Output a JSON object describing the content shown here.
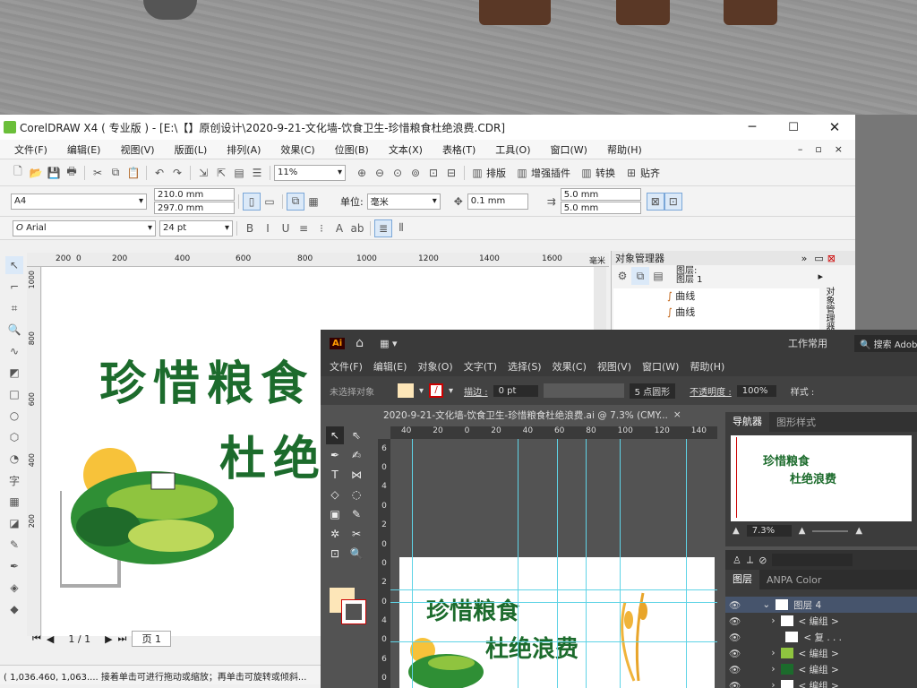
{
  "corel": {
    "title": "CorelDRAW X4 ( 专业版 ) - [E:\\【】原创设计\\2020-9-21-文化墙-饮食卫生-珍惜粮食杜绝浪费.CDR]",
    "menu": [
      "文件(F)",
      "编辑(E)",
      "视图(V)",
      "版面(L)",
      "排列(A)",
      "效果(C)",
      "位图(B)",
      "文本(X)",
      "表格(T)",
      "工具(O)",
      "窗口(W)",
      "帮助(H)"
    ],
    "zoom": "11%",
    "plugins": [
      "排版",
      "增强插件",
      "转换",
      "贴齐"
    ],
    "paper": "A4",
    "width": "210.0 mm",
    "height": "297.0 mm",
    "unit_label": "单位:",
    "unit": "毫米",
    "nudge": "0.1 mm",
    "dup_x": "5.0 mm",
    "dup_y": "5.0 mm",
    "font": "Arial",
    "font_size": "24 pt",
    "ruler_x": [
      "200",
      "0",
      "200",
      "400",
      "600",
      "800",
      "1000",
      "1200",
      "1400",
      "1600"
    ],
    "ruler_unit": "毫米",
    "ruler_y": [
      "1000",
      "800",
      "600",
      "400",
      "200"
    ],
    "obj_mgr": {
      "title": "对象管理器",
      "layer_a": "图层:",
      "layer_b": "图层 1",
      "items": [
        "曲线",
        "曲线"
      ],
      "side": "对象管理器"
    },
    "page_nav": "1 / 1",
    "page_tab": "页 1",
    "status": "( 1,036.460, 1,063.... 接着单击可进行拖动或缩放；再单击可旋转或倾斜...",
    "art_line1": "珍惜粮食",
    "art_line2": "杜绝"
  },
  "ai": {
    "logo": "Ai",
    "workspace": "工作常用",
    "search": "搜索 Adobe",
    "menu": [
      "文件(F)",
      "编辑(E)",
      "对象(O)",
      "文字(T)",
      "选择(S)",
      "效果(C)",
      "视图(V)",
      "窗口(W)",
      "帮助(H)"
    ],
    "no_sel": "未选择对象",
    "stroke_label": "描边 :",
    "stroke_val": "0 pt",
    "brush": "5 点圆形",
    "opacity_label": "不透明度 :",
    "opacity": "100%",
    "style_label": "样式 :",
    "doc_tab": "2020-9-21-文化墙-饮食卫生-珍惜粮食杜绝浪费.ai @ 7.3% (CMY...",
    "ruler": [
      "40",
      "20",
      "0",
      "20",
      "40",
      "60",
      "80",
      "100",
      "120",
      "140"
    ],
    "ruler_v": [
      "6",
      "0",
      "4",
      "0",
      "2",
      "0",
      "0",
      "2",
      "0",
      "4",
      "0",
      "6",
      "0"
    ],
    "nav_tab": "导航器",
    "gstyle_tab": "图形样式",
    "nav_zoom": "7.3%",
    "layers_tab": "图层",
    "color_tab": "ANPA Color",
    "layers": [
      "图层 4",
      "< 编组 >",
      "< 复 . . .",
      "< 编组 >",
      "< 编组 >",
      "< 编组 >"
    ],
    "art_line1": "珍惜粮食",
    "art_line2": "杜绝浪费"
  }
}
